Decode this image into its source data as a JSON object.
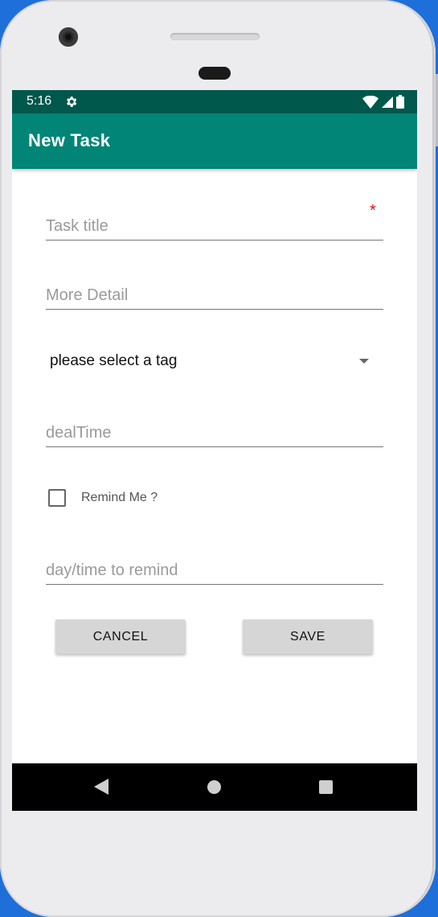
{
  "status_bar": {
    "time": "5:16"
  },
  "app_bar": {
    "title": "New Task"
  },
  "form": {
    "task_title_placeholder": "Task title",
    "required_marker": "*",
    "more_detail_placeholder": "More Detail",
    "tag_spinner_value": "please select a tag",
    "deal_time_placeholder": "dealTime",
    "remind_checkbox_label": "Remind Me ?",
    "remind_checked": false,
    "remind_time_placeholder": "day/time to remind"
  },
  "buttons": {
    "cancel": "CANCEL",
    "save": "SAVE"
  },
  "colors": {
    "status_bar": "#00574b",
    "app_bar": "#008577",
    "required_star": "#dd1111",
    "button_bg": "#d6d6d6"
  },
  "icons": {
    "status": [
      "settings-gear-icon",
      "wifi-icon",
      "cell-signal-icon",
      "battery-icon"
    ],
    "nav": [
      "back-icon",
      "home-icon",
      "recents-icon"
    ]
  }
}
